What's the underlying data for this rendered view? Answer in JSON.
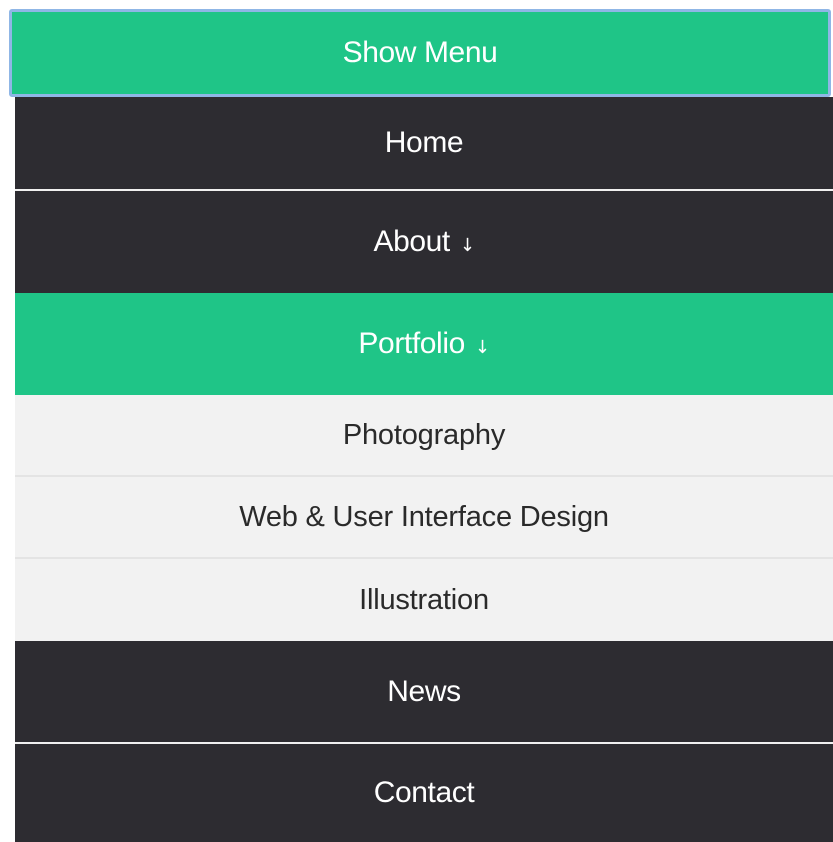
{
  "menu": {
    "toggle_label": "Show Menu",
    "items": [
      {
        "label": "Home",
        "arrow": ""
      },
      {
        "label": "About",
        "arrow": "↓"
      },
      {
        "label": "Portfolio",
        "arrow": "↓"
      },
      {
        "label": "News",
        "arrow": ""
      },
      {
        "label": "Contact",
        "arrow": ""
      }
    ],
    "portfolio_submenu": [
      {
        "label": "Photography"
      },
      {
        "label": "Web & User Interface Design"
      },
      {
        "label": "Illustration"
      }
    ]
  },
  "colors": {
    "accent": "#1fc587",
    "dark": "#2d2c31",
    "submenu_bg": "#f2f2f2",
    "focus_ring": "#8fb6e6"
  },
  "icons": {
    "dropdown_arrow": "down-arrow-icon"
  }
}
